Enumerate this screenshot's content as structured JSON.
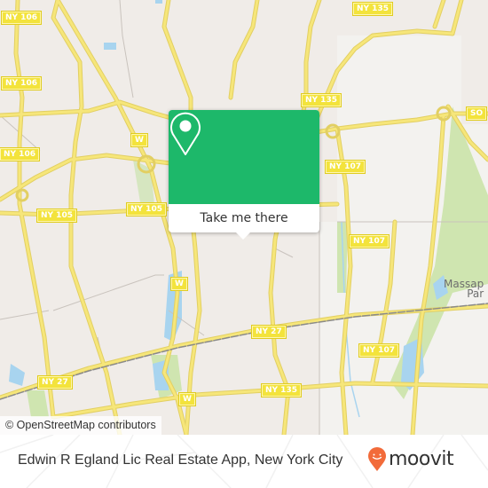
{
  "map": {
    "road_shields": [
      {
        "id": "ny106-a",
        "label": "NY 106"
      },
      {
        "id": "ny106-b",
        "label": "NY 106"
      },
      {
        "id": "ny106-c",
        "label": "NY 106"
      },
      {
        "id": "ny105-a",
        "label": "NY 105"
      },
      {
        "id": "ny105-b",
        "label": "NY 105"
      },
      {
        "id": "w-a",
        "label": "W"
      },
      {
        "id": "w-b",
        "label": "W"
      },
      {
        "id": "w-c",
        "label": "W"
      },
      {
        "id": "ny135-a",
        "label": "NY 135"
      },
      {
        "id": "ny135-b",
        "label": "NY 135"
      },
      {
        "id": "ny135-c",
        "label": "NY 135"
      },
      {
        "id": "so",
        "label": "SO"
      },
      {
        "id": "ny107-a",
        "label": "NY 107"
      },
      {
        "id": "ny107-b",
        "label": "NY 107"
      },
      {
        "id": "ny107-c",
        "label": "NY 107"
      },
      {
        "id": "ny27-a",
        "label": "NY 27"
      },
      {
        "id": "ny27-b",
        "label": "NY 27"
      }
    ],
    "place_labels": [
      {
        "line1": "Massap",
        "line2": "Par"
      }
    ],
    "attribution": "© OpenStreetMap contributors",
    "colors": {
      "land": "#f0ece8",
      "road": "#f6e67a",
      "water": "#a8d4ef",
      "park": "#cfe5b0",
      "shield": "#f3e33c"
    }
  },
  "popup": {
    "icon": "map-pin-icon",
    "button_label": "Take me there",
    "accent_color": "#1db86a"
  },
  "footer": {
    "title": "Edwin R Egland Lic Real Estate App, New York City",
    "brand_name": "moovit",
    "brand_icon": "moovit-pin-logo-icon",
    "brand_color": "#f26b3a"
  }
}
